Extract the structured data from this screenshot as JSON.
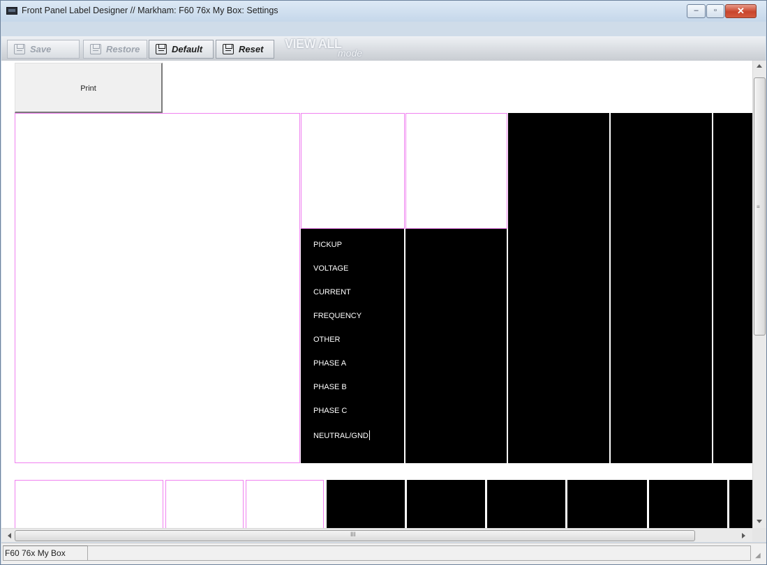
{
  "window": {
    "title": "Front Panel Label Designer // Markham: F60 76x My Box: Settings",
    "controls": {
      "minimize": "–",
      "maximize": "▫",
      "close": "✕"
    }
  },
  "toolbar": {
    "save_label": "Save",
    "restore_label": "Restore",
    "default_label": "Default",
    "reset_label": "Reset",
    "view_all_label": "VIEW ALL",
    "view_all_mode": "mode"
  },
  "content": {
    "print_label": "Print",
    "led_labels": [
      "PICKUP",
      "VOLTAGE",
      "CURRENT",
      "FREQUENCY",
      "OTHER",
      "PHASE A",
      "PHASE B",
      "PHASE C",
      "NEUTRAL/GND"
    ]
  },
  "scrollbars": {
    "vertical_grip": "≡",
    "horizontal_grip": "III"
  },
  "statusbar": {
    "device_name": "F60 76x My Box"
  },
  "colors": {
    "panel_border": "#f081f0",
    "filled_panel": "#000000",
    "label_text": "#ffffff",
    "titlebar": "#cfdce9"
  }
}
